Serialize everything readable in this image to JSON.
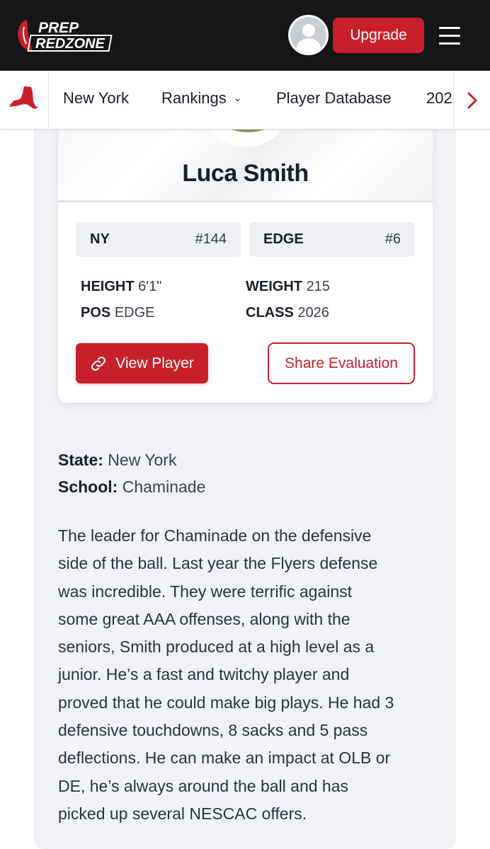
{
  "header": {
    "logo_line1": "PREP",
    "logo_line2": "REDZONE",
    "upgrade_label": "Upgrade"
  },
  "subnav": {
    "items": [
      {
        "label": "New York"
      },
      {
        "label": "Rankings",
        "has_dropdown": true
      },
      {
        "label": "Player Database"
      },
      {
        "label": "202"
      }
    ],
    "next_arrow": "›"
  },
  "player": {
    "name": "Luca Smith",
    "rankings": [
      {
        "label": "NY",
        "rank": "#144"
      },
      {
        "label": "EDGE",
        "rank": "#6"
      }
    ],
    "stats": {
      "height_label": "HEIGHT",
      "height_value": "6'1\"",
      "weight_label": "WEIGHT",
      "weight_value": "215",
      "pos_label": "POS",
      "pos_value": "EDGE",
      "class_label": "CLASS",
      "class_value": "2026"
    },
    "view_player_label": "View Player",
    "share_label": "Share Evaluation"
  },
  "info": {
    "state_label": "State:",
    "state_value": "New York",
    "school_label": "School:",
    "school_value": "Chaminade"
  },
  "bio_lines": [
    "The leader for Chaminade on the defensive",
    "side of the ball. Last year the Flyers defense",
    "was incredible. They were terrific against",
    "some great AAA offenses, along with the",
    "seniors, Smith produced at a high level as a",
    "junior. He’s a fast and twitchy player and",
    "proved that he could make big plays. He had 3",
    "defensive touchdowns, 8 sacks and 5 pass",
    "deflections. He can make an impact at OLB or",
    "DE, he’s always around the ball and has",
    "picked up several NESCAC offers."
  ],
  "colors": {
    "brand_red": "#c8202a",
    "header_dark": "#151617",
    "panel_bg": "#f0f2f6"
  }
}
